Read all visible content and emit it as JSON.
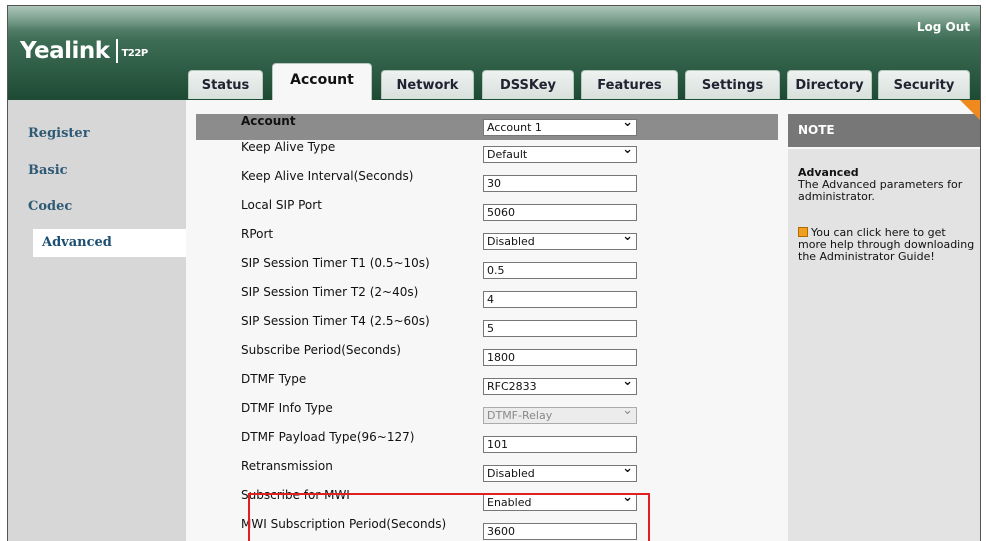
{
  "header": {
    "brand": "Yealink",
    "model": "T22P",
    "logout_label": "Log Out"
  },
  "tabs": [
    {
      "label": "Status"
    },
    {
      "label": "Account"
    },
    {
      "label": "Network"
    },
    {
      "label": "DSSKey"
    },
    {
      "label": "Features"
    },
    {
      "label": "Settings"
    },
    {
      "label": "Directory"
    },
    {
      "label": "Security"
    }
  ],
  "active_tab": "Account",
  "sidebar": {
    "items": [
      {
        "label": "Register"
      },
      {
        "label": "Basic"
      },
      {
        "label": "Codec"
      },
      {
        "label": "Advanced"
      }
    ],
    "active": "Advanced"
  },
  "form": {
    "account": {
      "label": "Account",
      "value": "Account 1"
    },
    "rows": [
      {
        "label": "Keep Alive Type",
        "value": "Default"
      },
      {
        "label": "Keep Alive Interval(Seconds)",
        "value": "30"
      },
      {
        "label": "Local SIP Port",
        "value": "5060"
      },
      {
        "label": "RPort",
        "value": "Disabled"
      },
      {
        "label": "SIP Session Timer T1 (0.5~10s)",
        "value": "0.5"
      },
      {
        "label": "SIP Session Timer T2 (2~40s)",
        "value": "4"
      },
      {
        "label": "SIP Session Timer T4 (2.5~60s)",
        "value": "5"
      },
      {
        "label": "Subscribe Period(Seconds)",
        "value": "1800"
      },
      {
        "label": "DTMF Type",
        "value": "RFC2833"
      },
      {
        "label": "DTMF Info Type",
        "value": "DTMF-Relay"
      },
      {
        "label": "DTMF Payload Type(96~127)",
        "value": "101"
      },
      {
        "label": "Retransmission",
        "value": "Disabled"
      },
      {
        "label": "Subscribe for MWI",
        "value": "Enabled"
      },
      {
        "label": "MWI Subscription Period(Seconds)",
        "value": "3600"
      }
    ]
  },
  "note": {
    "title": "NOTE",
    "advanced_title": "Advanced",
    "advanced_text": "The Advanced parameters for administrator.",
    "help_text": "You can click here to get more help through downloading the Administrator Guide!"
  },
  "colors": {
    "header_green": "#1c4a33",
    "note_corner": "#f08a1e",
    "highlight": "#e02020",
    "sidebar_link": "#2e5a75"
  }
}
